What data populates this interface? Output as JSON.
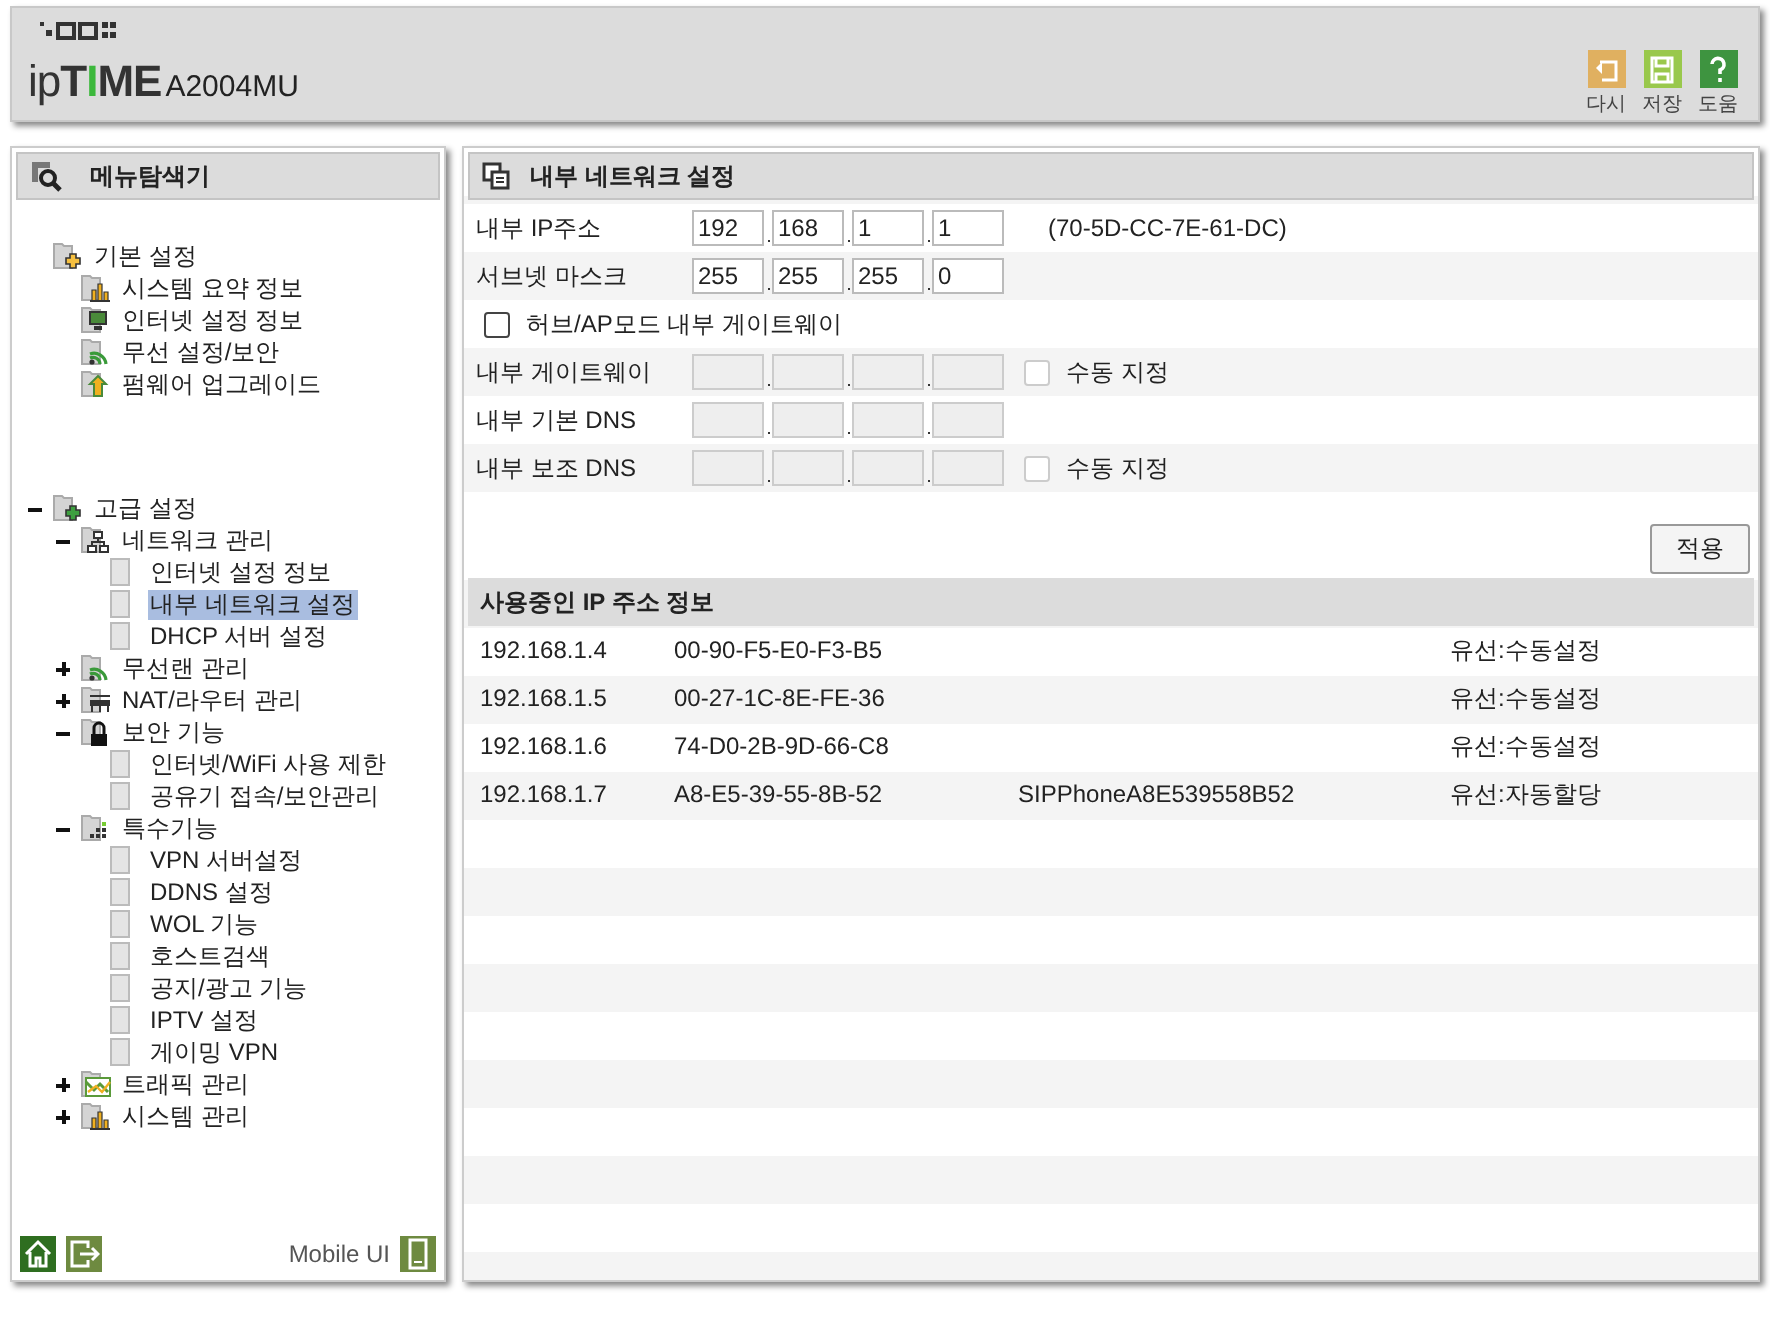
{
  "header": {
    "brand": "ipTIME",
    "model": "A2004MU",
    "actions": [
      {
        "label": "다시",
        "kind": "undo"
      },
      {
        "label": "저장",
        "kind": "save"
      },
      {
        "label": "도움",
        "kind": "help"
      }
    ]
  },
  "sidebar": {
    "title": "메뉴탐색기",
    "tree": [
      {
        "label": "기본 설정",
        "kind": "folder-basic",
        "children": [
          {
            "label": "시스템 요약 정보",
            "kind": "chart",
            "selected": false
          },
          {
            "label": "인터넷 설정 정보",
            "kind": "monitor",
            "selected": false
          },
          {
            "label": "무선 설정/보안",
            "kind": "wifi",
            "selected": false
          },
          {
            "label": "펌웨어 업그레이드",
            "kind": "upload",
            "selected": false
          }
        ]
      },
      {
        "label": "고급 설정",
        "kind": "folder-advanced",
        "expanded": true,
        "children": [
          {
            "label": "네트워크 관리",
            "kind": "network",
            "expanded": true,
            "children": [
              {
                "label": "인터넷 설정 정보",
                "kind": "page",
                "selected": false
              },
              {
                "label": "내부 네트워크 설정",
                "kind": "page",
                "selected": true
              },
              {
                "label": "DHCP 서버 설정",
                "kind": "page",
                "selected": false
              }
            ]
          },
          {
            "label": "무선랜 관리",
            "kind": "wifi",
            "expanded": false
          },
          {
            "label": "NAT/라우터 관리",
            "kind": "router",
            "expanded": false
          },
          {
            "label": "보안 기능",
            "kind": "lock",
            "expanded": true,
            "children": [
              {
                "label": "인터넷/WiFi 사용 제한",
                "kind": "page",
                "selected": false
              },
              {
                "label": "공유기 접속/보안관리",
                "kind": "page",
                "selected": false
              }
            ]
          },
          {
            "label": "특수기능",
            "kind": "grid",
            "expanded": true,
            "children": [
              {
                "label": "VPN 서버설정",
                "kind": "page",
                "selected": false
              },
              {
                "label": "DDNS 설정",
                "kind": "page",
                "selected": false
              },
              {
                "label": "WOL 기능",
                "kind": "page",
                "selected": false
              },
              {
                "label": "호스트검색",
                "kind": "page",
                "selected": false
              },
              {
                "label": "공지/광고 기능",
                "kind": "page",
                "selected": false
              },
              {
                "label": "IPTV 설정",
                "kind": "page",
                "selected": false
              },
              {
                "label": "게이밍 VPN",
                "kind": "page",
                "selected": false
              }
            ]
          },
          {
            "label": "트래픽 관리",
            "kind": "traffic",
            "expanded": false
          },
          {
            "label": "시스템 관리",
            "kind": "chart",
            "expanded": false
          }
        ]
      }
    ],
    "footer": {
      "mobile_label": "Mobile UI"
    }
  },
  "settings": {
    "title": "내부 네트워크 설정",
    "rows": [
      {
        "kind": "ip",
        "label": "내부 IP주소",
        "octets": [
          "192",
          "168",
          "1",
          "1"
        ],
        "disabled": false,
        "note": "(70-5D-CC-7E-61-DC)"
      },
      {
        "kind": "ip",
        "label": "서브넷 마스크",
        "octets": [
          "255",
          "255",
          "255",
          "0"
        ],
        "disabled": false
      },
      {
        "kind": "checkbox",
        "label": "허브/AP모드 내부 게이트웨이",
        "checked": false
      },
      {
        "kind": "ip",
        "label": "내부 게이트웨이",
        "octets": [],
        "disabled": true,
        "manual": {
          "label": "수동 지정",
          "checked": false
        }
      },
      {
        "kind": "ip",
        "label": "내부 기본 DNS",
        "octets": [],
        "disabled": true
      },
      {
        "kind": "ip",
        "label": "내부 보조 DNS",
        "octets": [],
        "disabled": true,
        "manual": {
          "label": "수동 지정",
          "checked": false
        }
      }
    ],
    "apply_button": "적용"
  },
  "clients": {
    "title": "사용중인 IP 주소 정보",
    "rows": [
      {
        "ip": "192.168.1.4",
        "mac": "00-90-F5-E0-F3-B5",
        "type": "유선:수동설정"
      },
      {
        "ip": "192.168.1.5",
        "mac": "00-27-1C-8E-FE-36",
        "type": "유선:수동설정"
      },
      {
        "ip": "192.168.1.6",
        "mac": "74-D0-2B-9D-66-C8",
        "type": "유선:수동설정"
      },
      {
        "ip": "192.168.1.7",
        "mac": "A8-E5-39-55-8B-52",
        "name": "SIPPhoneA8E539558B52",
        "type": "유선:자동할당"
      }
    ]
  }
}
